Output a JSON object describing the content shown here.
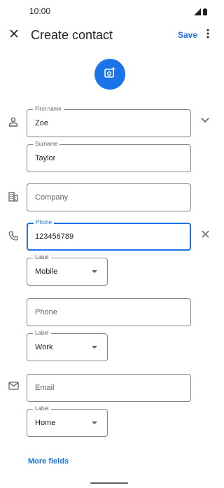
{
  "status_bar": {
    "time": "10:00",
    "wifi_icon": "signal-icon",
    "battery_icon": "battery-icon"
  },
  "app_bar": {
    "close_icon": "close-icon",
    "title": "Create contact",
    "save_label": "Save",
    "menu_icon": "more-vert-icon"
  },
  "photo": {
    "icon": "add-photo-icon",
    "color": "#1a73e8"
  },
  "name": {
    "section_icon": "person-icon",
    "first_name": {
      "label": "First name",
      "value": "Zoe"
    },
    "surname": {
      "label": "Surname",
      "value": "Taylor"
    },
    "expand_icon": "chevron-down-icon"
  },
  "company": {
    "section_icon": "business-icon",
    "placeholder": "Company"
  },
  "phone": {
    "section_icon": "phone-icon",
    "primary": {
      "label": "Phone",
      "value": "123456789"
    },
    "primary_type": {
      "label": "Label",
      "value": "Mobile"
    },
    "clear_icon": "close-icon",
    "secondary_placeholder": "Phone",
    "secondary_type": {
      "label": "Label",
      "value": "Work"
    }
  },
  "email": {
    "section_icon": "mail-icon",
    "placeholder": "Email",
    "type": {
      "label": "Label",
      "value": "Home"
    }
  },
  "more_fields": "More fields",
  "colors": {
    "accent": "#1a73e8",
    "outline": "#80868b",
    "icon": "#5f6368"
  }
}
